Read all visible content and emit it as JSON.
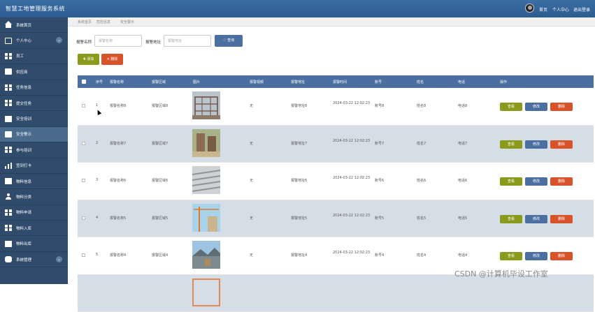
{
  "app": {
    "title": "智慧工地管理服务系统",
    "nav": [
      "首页",
      "个人中心",
      "退出登录"
    ]
  },
  "sidebar": {
    "items": [
      {
        "label": "系统首页",
        "icon": "home-icon",
        "chevron": false
      },
      {
        "label": "个人中心",
        "icon": "profile-icon",
        "chevron": true
      },
      {
        "label": "员工",
        "icon": "grid-icon",
        "chevron": false
      },
      {
        "label": "供应商",
        "icon": "card-icon",
        "chevron": false
      },
      {
        "label": "任务信息",
        "icon": "grid-icon",
        "chevron": false
      },
      {
        "label": "提交任务",
        "icon": "grid-icon",
        "chevron": false
      },
      {
        "label": "安全培训",
        "icon": "doc-icon",
        "chevron": false
      },
      {
        "label": "安全警示",
        "icon": "card-icon",
        "chevron": false,
        "active": true
      },
      {
        "label": "参与培训",
        "icon": "grid-icon",
        "chevron": false
      },
      {
        "label": "签到打卡",
        "icon": "bar-chart-icon",
        "chevron": false
      },
      {
        "label": "物料信息",
        "icon": "doc-icon",
        "chevron": false
      },
      {
        "label": "物料分类",
        "icon": "user-icon",
        "chevron": false
      },
      {
        "label": "物料申请",
        "icon": "grid-icon",
        "chevron": false
      },
      {
        "label": "物料入库",
        "icon": "grid-icon",
        "chevron": false
      },
      {
        "label": "物料出库",
        "icon": "doc-icon",
        "chevron": false
      },
      {
        "label": "系统管理",
        "icon": "chat-icon",
        "chevron": true
      }
    ]
  },
  "breadcrumb": [
    "系统首页",
    "危险信息",
    "安全警示"
  ],
  "search": {
    "name_label": "报警名称",
    "name_placeholder": "报警名称",
    "addr_label": "报警地址",
    "addr_placeholder": "报警地址",
    "query_label": "查询"
  },
  "toolbar": {
    "add_label": "添加",
    "delete_label": "删除"
  },
  "table": {
    "headers": [
      "序号",
      "报警名称",
      "报警区域",
      "图片",
      "报警视频",
      "报警地址",
      "报警时间",
      "账号",
      "姓名",
      "电话",
      "操作"
    ],
    "actions": {
      "view": "查看",
      "edit": "修改",
      "delete": "删除"
    },
    "rows": [
      {
        "no": "1",
        "name": "报警名称8",
        "area": "报警区域8",
        "video": "无",
        "addr": "报警地址8",
        "time": "2024-03-22 12:02:23",
        "account": "账号8",
        "person": "姓名8",
        "phone": "电话8"
      },
      {
        "no": "2",
        "name": "报警名称7",
        "area": "报警区域7",
        "video": "无",
        "addr": "报警地址7",
        "time": "2024-03-22 12:02:23",
        "account": "账号7",
        "person": "姓名7",
        "phone": "电话7"
      },
      {
        "no": "3",
        "name": "报警名称6",
        "area": "报警区域6",
        "video": "无",
        "addr": "报警地址6",
        "time": "2024-03-22 12:02:23",
        "account": "账号6",
        "person": "姓名6",
        "phone": "电话6"
      },
      {
        "no": "4",
        "name": "报警名称5",
        "area": "报警区域5",
        "video": "无",
        "addr": "报警地址5",
        "time": "2024-03-22 12:02:23",
        "account": "账号5",
        "person": "姓名5",
        "phone": "电话5"
      },
      {
        "no": "5",
        "name": "报警名称4",
        "area": "报警区域4",
        "video": "无",
        "addr": "报警地址4",
        "time": "2024-03-22 12:02:23",
        "account": "账号4",
        "person": "姓名4",
        "phone": "电话4"
      }
    ]
  },
  "watermark": "CSDN @计算机毕设工作室"
}
